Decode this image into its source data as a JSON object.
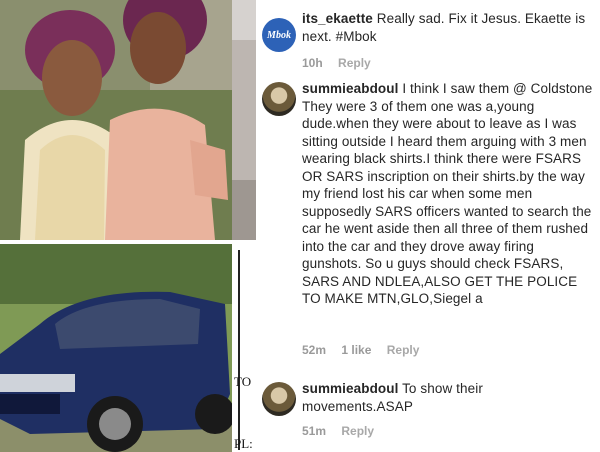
{
  "comments": [
    {
      "username": "its_ekaette",
      "avatar": "Mbok",
      "text": "Really sad. Fix it Jesus. Ekaette is next. #Mbok",
      "time": "10h",
      "likes": "",
      "reply_label": "Reply"
    },
    {
      "username": "summieabdoul",
      "text": "I think I saw them @ Coldstone They were 3 of them one was a,young dude.when they were about to leave as I was sitting outside I heard them arguing with 3 men wearing black shirts.I think there were FSARS OR SARS inscription on their shirts.by the way my friend lost his car when  some men supposedly SARS officers wanted to search the car he went aside then all three of them rushed into the car and they drove away firing gunshots. So u guys should check FSARS, SARS AND NDLEA,ALSO GET THE POLICE TO MAKE MTN,GLO,Siegel a",
      "time": "52m",
      "likes": "1 like",
      "reply_label": "Reply"
    },
    {
      "username": "summieabdoul",
      "text": "To show their movements.ASAP",
      "time": "51m",
      "likes": "",
      "reply_label": "Reply"
    }
  ],
  "clipped_text": [
    "TO",
    "PL:"
  ],
  "colors": {
    "username": "#262626",
    "meta": "#9a9a9a",
    "mbok_avatar": "#2d62b7",
    "car": "#1f2f63"
  },
  "images": {
    "top_photo": "two women posing, one in cream beaded dress with purple headwrap, one in peach fringed dress",
    "car_photo": "dark blue SUV parked on grass"
  }
}
